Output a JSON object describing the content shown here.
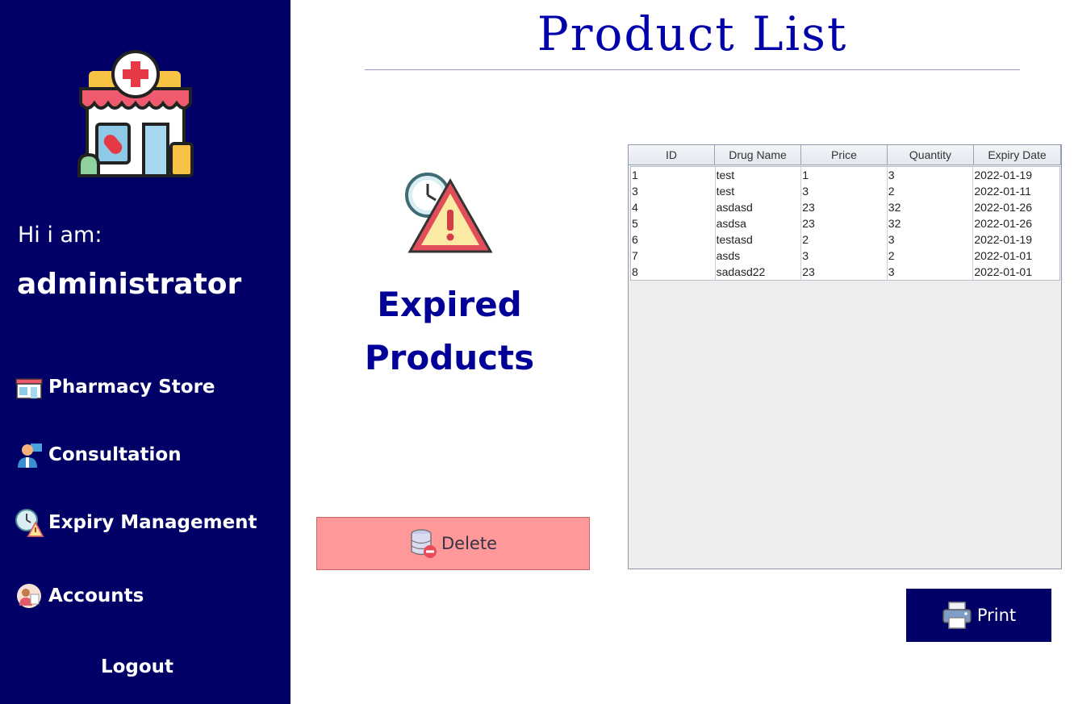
{
  "sidebar": {
    "greeting": "Hi i am:",
    "username": "administrator",
    "nav": [
      {
        "label": "Pharmacy Store",
        "icon": "store-icon"
      },
      {
        "label": "Consultation",
        "icon": "doctor-icon"
      },
      {
        "label": "Expiry Management",
        "icon": "clock-warning-icon"
      },
      {
        "label": "Accounts",
        "icon": "accounts-icon"
      }
    ],
    "logout_label": "Logout"
  },
  "header": {
    "title": "Product List"
  },
  "main": {
    "section_label_line1": "Expired",
    "section_label_line2": "Products",
    "delete_label": "Delete",
    "print_label": "Print"
  },
  "table": {
    "columns": [
      "ID",
      "Drug Name",
      "Price",
      "Quantity",
      "Expiry Date"
    ],
    "rows": [
      [
        "1",
        "test",
        "1",
        "3",
        "2022-01-19"
      ],
      [
        "3",
        "test",
        "3",
        "2",
        "2022-01-11"
      ],
      [
        "4",
        "asdasd",
        "23",
        "32",
        "2022-01-26"
      ],
      [
        "5",
        "asdsa",
        "23",
        "32",
        "2022-01-26"
      ],
      [
        "6",
        "testasd",
        "2",
        "3",
        "2022-01-19"
      ],
      [
        "7",
        "asds",
        "3",
        "2",
        "2022-01-01"
      ],
      [
        "8",
        "sadasd22",
        "23",
        "3",
        "2022-01-01"
      ]
    ]
  },
  "colors": {
    "sidebar_bg": "#000066",
    "title": "#0000aa",
    "delete_bg": "#ff9999",
    "print_bg": "#000066"
  }
}
